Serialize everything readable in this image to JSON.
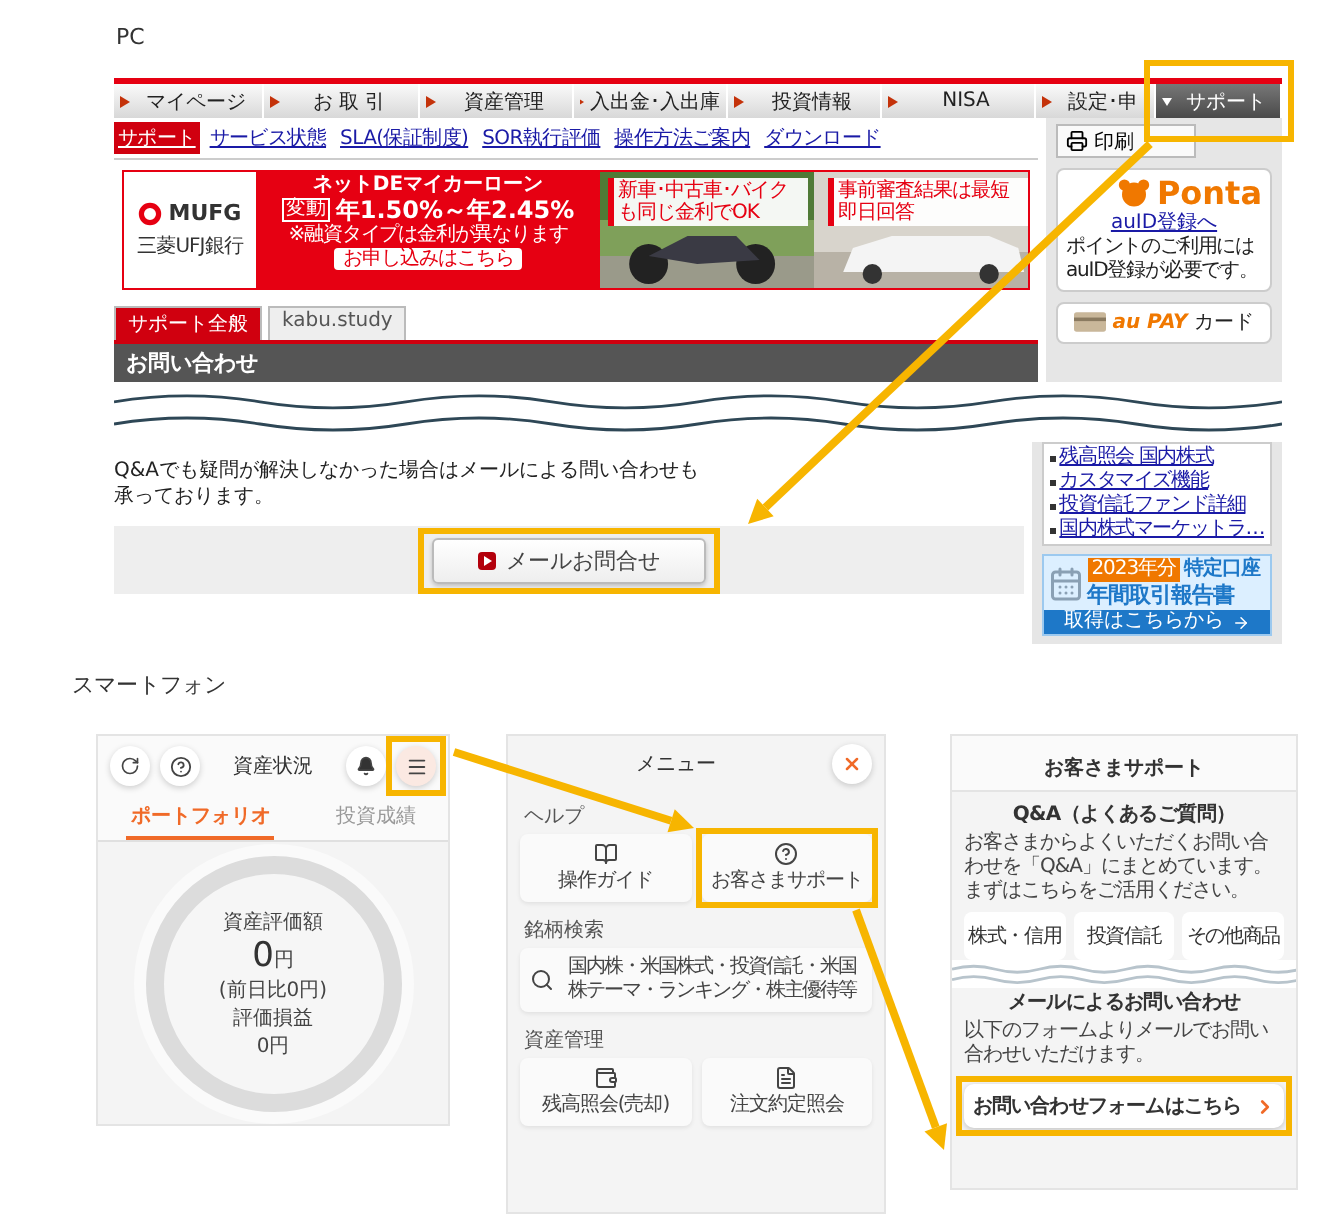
{
  "pc": {
    "label": "PC",
    "nav_tabs": [
      {
        "label": "マイページ",
        "selected": false,
        "highlighted": false
      },
      {
        "label": "お 取 引",
        "selected": false,
        "highlighted": false
      },
      {
        "label": "資産管理",
        "selected": false,
        "highlighted": false
      },
      {
        "label": "入出金･入出庫",
        "selected": false,
        "highlighted": false
      },
      {
        "label": "投資情報",
        "selected": false,
        "highlighted": false
      },
      {
        "label": "NISA",
        "selected": false,
        "highlighted": false
      },
      {
        "label": "設定･申",
        "selected": false,
        "highlighted": false
      },
      {
        "label": "サポート",
        "selected": true,
        "highlighted": true
      }
    ],
    "sub_links": [
      {
        "label": "サポート",
        "selected": true
      },
      {
        "label": "サービス状態",
        "selected": false
      },
      {
        "label": "SLA(保証制度)",
        "selected": false
      },
      {
        "label": "SOR執行評価",
        "selected": false
      },
      {
        "label": "操作方法ご案内",
        "selected": false
      },
      {
        "label": "ダウンロード",
        "selected": false
      }
    ],
    "banner": {
      "brand": "MUFG",
      "bank": "三菱UFJ銀行",
      "title": "ネットDEマイカーローン",
      "badge": "変動",
      "rate": "年1.50%～年2.45%",
      "note": "※融資タイプは金利が異なります",
      "button": "お申し込みはこちら",
      "callouts": [
        "新車･中古車･バイクも同じ金利でOK",
        "事前審査結果は最短即日回答"
      ]
    },
    "content_tabs": [
      {
        "label": "サポート全般",
        "selected": true
      },
      {
        "label": "kabu.study",
        "selected": false
      }
    ],
    "section_title": "お問い合わせ",
    "message": "Q&Aでも疑問が解決しなかった場合はメールによる問い合わせも承っております。",
    "mail_button": {
      "label": "メールお問合せ",
      "highlighted": true
    },
    "sidebar": {
      "print_button": "印刷",
      "ponta": {
        "logo": "Ponta",
        "link": "auID登録へ",
        "text": "ポイントのご利用にはauID登録が必要です。"
      },
      "card_promo": {
        "logo": "au PAY",
        "label": "カード"
      },
      "links": [
        "残高照会 国内株式",
        "カスタマイズ機能",
        "投資信託ファンド詳細",
        "国内株式マーケットラ…"
      ],
      "report": {
        "year": "2023年分",
        "badge": "特定口座",
        "title": "年間取引報告書",
        "footer": "取得はこちらから"
      }
    }
  },
  "smartphone": {
    "label": "スマートフォン",
    "portfolio_screen": {
      "title": "資産状況",
      "menu_highlighted": true,
      "tabs": [
        {
          "label": "ポートフォリオ",
          "selected": true
        },
        {
          "label": "投資成績",
          "selected": false
        }
      ],
      "summary": {
        "label": "資産評価額",
        "value": "0",
        "unit": "円",
        "change": "(前日比0円)",
        "pl_label": "評価損益",
        "pl_value": "0円"
      }
    },
    "menu_screen": {
      "title": "メニュー",
      "groups": [
        {
          "heading": "ヘルプ",
          "tiles": [
            {
              "kind": "guide",
              "label": "操作ガイド",
              "highlighted": false
            },
            {
              "kind": "support",
              "label": "お客さまサポート",
              "highlighted": true
            }
          ]
        },
        {
          "heading": "銘柄検索",
          "tiles": [
            {
              "kind": "search",
              "label": "国内株・米国株式・投資信託・米国株テーマ・ランキング・株主優待等",
              "highlighted": false
            }
          ]
        },
        {
          "heading": "資産管理",
          "tiles": [
            {
              "kind": "balance",
              "label": "残高照会(売却)",
              "highlighted": false
            },
            {
              "kind": "orders",
              "label": "注文約定照会",
              "highlighted": false
            }
          ]
        }
      ]
    },
    "support_screen": {
      "title": "お客さまサポート",
      "qa_title": "Q&A（よくあるご質問）",
      "qa_text": "お客さまからよくいただくお問い合わせを「Q&A」にまとめています。まずはこちらをご活用ください。",
      "categories": [
        "株式・信用",
        "投資信託",
        "その他商品"
      ],
      "mail_title": "メールによるお問い合わせ",
      "mail_text": "以下のフォームよりメールでお問い合わせいただけます。",
      "form_button": {
        "label": "お問い合わせフォームはこちら",
        "highlighted": true
      }
    }
  }
}
